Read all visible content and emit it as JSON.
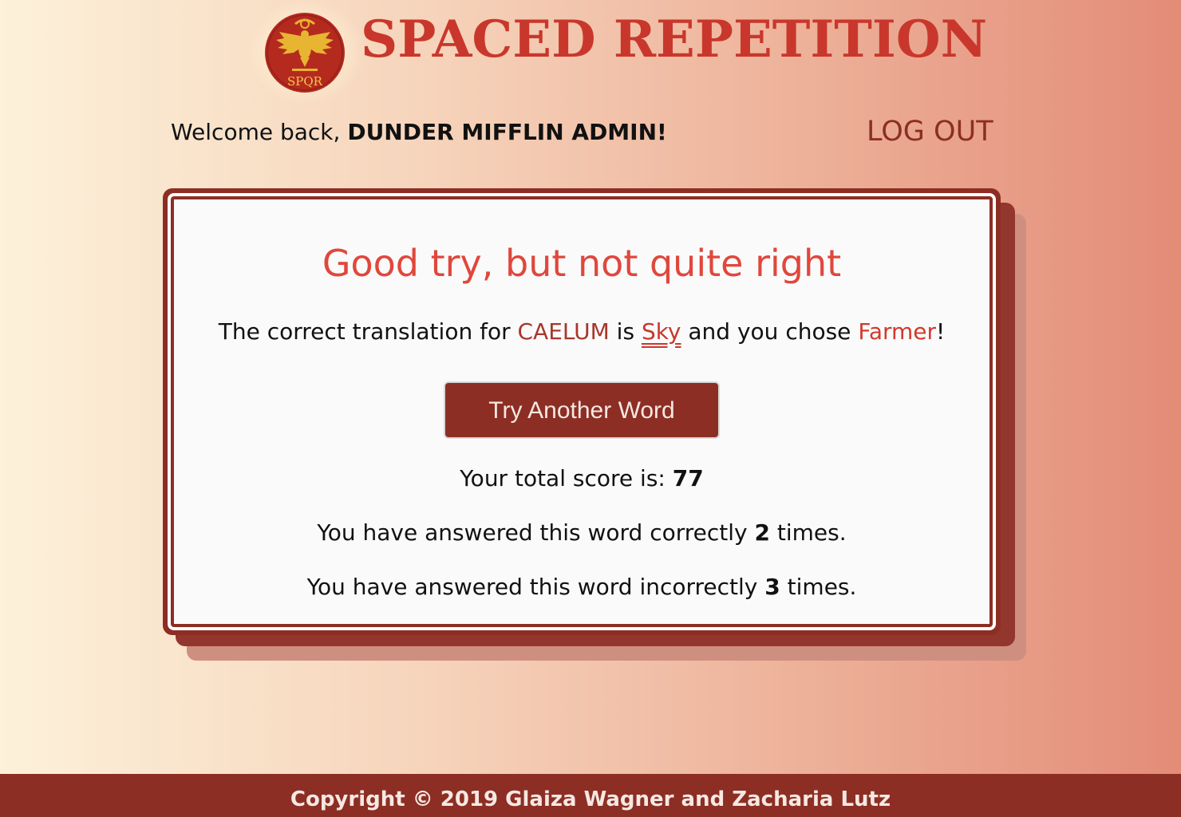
{
  "header": {
    "title": "SPACED REPETITION",
    "logo_text": "SPQR",
    "logo_colors": {
      "disc": "#b52a1f",
      "eagle": "#e7b531",
      "text": "#f2c64a"
    }
  },
  "nav": {
    "welcome_prefix": "Welcome back, ",
    "user_name": "DUNDER MIFFLIN ADMIN!",
    "logout_label": "LOG OUT"
  },
  "feedback": {
    "title": "Good try, but not quite right",
    "sentence_1": "The correct translation for ",
    "latin_word": "CAELUM",
    "sentence_2": " is ",
    "correct_answer": "Sky",
    "sentence_3": " and you chose ",
    "guess": "Farmer",
    "sentence_4": "!",
    "button_label": "Try Another Word",
    "score_label": "Your total score is: ",
    "score_value": "77",
    "correct_prefix": "You have answered this word correctly ",
    "correct_value": "2",
    "correct_suffix": " times.",
    "incorrect_prefix": "You have answered this word incorrectly ",
    "incorrect_value": "3",
    "incorrect_suffix": " times."
  },
  "footer": {
    "copyright": "Copyright © 2019 Glaiza Wagner and Zacharia Lutz"
  },
  "colors": {
    "brand_red": "#c9372c",
    "dark_red": "#8c2e24",
    "error_text": "#e0473c",
    "bg_left": "#fdf1da",
    "bg_right": "#e38c78"
  }
}
